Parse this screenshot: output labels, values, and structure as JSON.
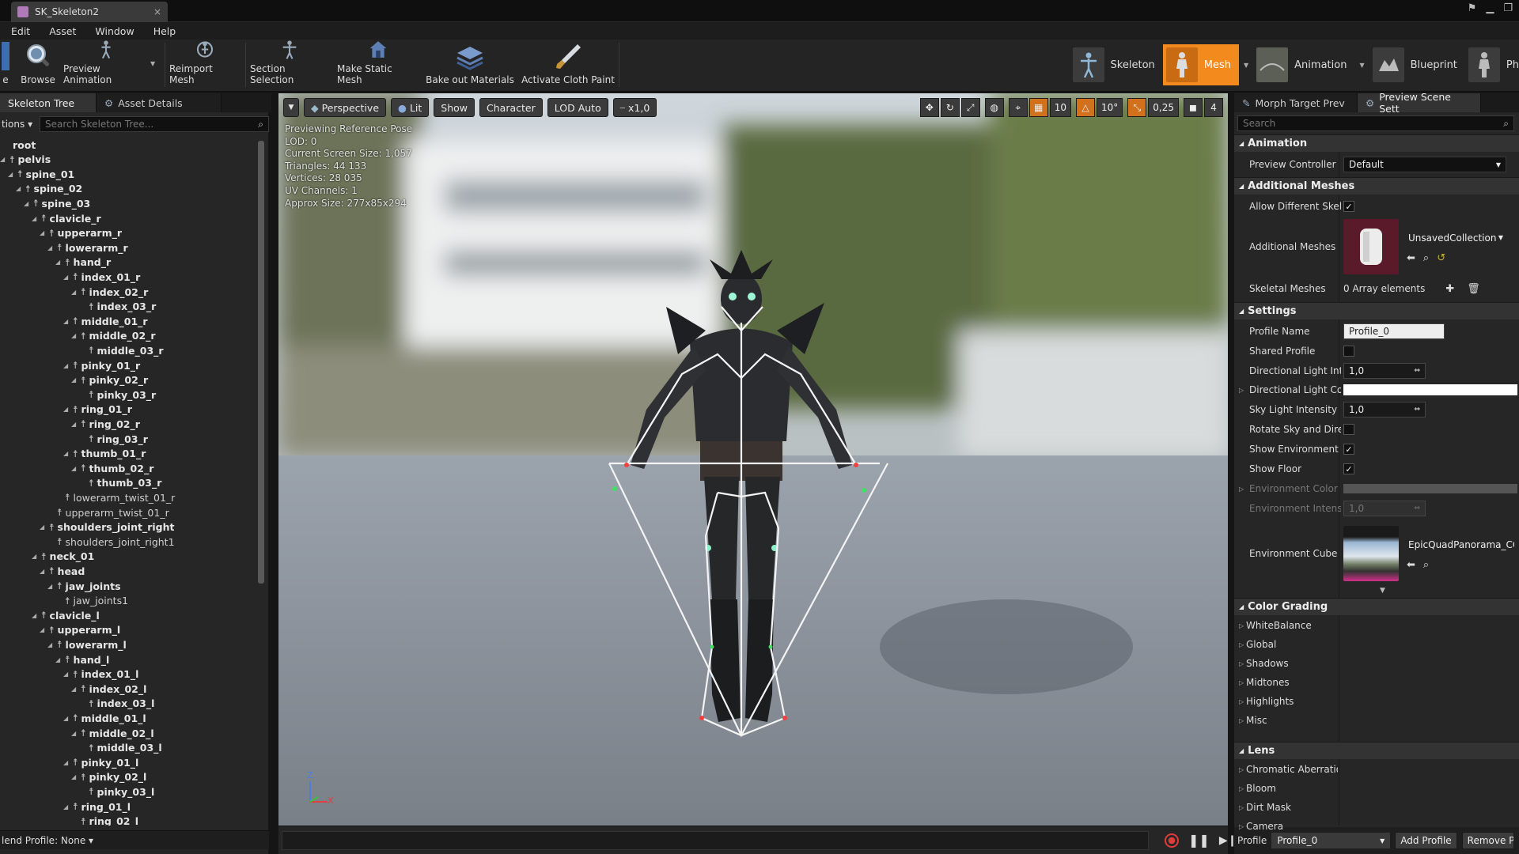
{
  "window": {
    "tab_title": "SK_Skeleton2"
  },
  "menu": [
    "Edit",
    "Asset",
    "Window",
    "Help"
  ],
  "toolbar": {
    "items": [
      {
        "label": "Browse",
        "icon": "magnifier-icon"
      },
      {
        "label": "Preview Animation",
        "icon": "running-figure-icon"
      },
      {
        "label": "Reimport Mesh",
        "icon": "reimport-icon"
      },
      {
        "label": "Section Selection",
        "icon": "mannequin-icon"
      },
      {
        "label": "Make Static Mesh",
        "icon": "house-icon"
      },
      {
        "label": "Bake out Materials",
        "icon": "layers-icon"
      },
      {
        "label": "Activate Cloth Paint",
        "icon": "brush-icon"
      }
    ],
    "first_partial_label": "e",
    "modes": [
      {
        "label": "Skeleton"
      },
      {
        "label": "Mesh",
        "active": true
      },
      {
        "label": "Animation"
      },
      {
        "label": "Blueprint"
      },
      {
        "label": "Ph"
      }
    ]
  },
  "left_panel": {
    "tabs": [
      "Skeleton Tree",
      "Asset Details"
    ],
    "options_label": "tions",
    "search_placeholder": "Search Skeleton Tree...",
    "bones": [
      {
        "name": "root",
        "depth": 0,
        "bold": true
      },
      {
        "name": "pelvis",
        "depth": 0,
        "bold": true
      },
      {
        "name": "spine_01",
        "depth": 1,
        "bold": true
      },
      {
        "name": "spine_02",
        "depth": 2,
        "bold": true
      },
      {
        "name": "spine_03",
        "depth": 3,
        "bold": true
      },
      {
        "name": "clavicle_r",
        "depth": 4,
        "bold": true
      },
      {
        "name": "upperarm_r",
        "depth": 5,
        "bold": true
      },
      {
        "name": "lowerarm_r",
        "depth": 6,
        "bold": true
      },
      {
        "name": "hand_r",
        "depth": 7,
        "bold": true
      },
      {
        "name": "index_01_r",
        "depth": 8,
        "bold": true
      },
      {
        "name": "index_02_r",
        "depth": 9,
        "bold": true
      },
      {
        "name": "index_03_r",
        "depth": 10,
        "bold": true
      },
      {
        "name": "middle_01_r",
        "depth": 8,
        "bold": true
      },
      {
        "name": "middle_02_r",
        "depth": 9,
        "bold": true
      },
      {
        "name": "middle_03_r",
        "depth": 10,
        "bold": true
      },
      {
        "name": "pinky_01_r",
        "depth": 8,
        "bold": true
      },
      {
        "name": "pinky_02_r",
        "depth": 9,
        "bold": true
      },
      {
        "name": "pinky_03_r",
        "depth": 10,
        "bold": true
      },
      {
        "name": "ring_01_r",
        "depth": 8,
        "bold": true
      },
      {
        "name": "ring_02_r",
        "depth": 9,
        "bold": true
      },
      {
        "name": "ring_03_r",
        "depth": 10,
        "bold": true
      },
      {
        "name": "thumb_01_r",
        "depth": 8,
        "bold": true
      },
      {
        "name": "thumb_02_r",
        "depth": 9,
        "bold": true
      },
      {
        "name": "thumb_03_r",
        "depth": 10,
        "bold": true
      },
      {
        "name": "lowerarm_twist_01_r",
        "depth": 7,
        "bold": false
      },
      {
        "name": "upperarm_twist_01_r",
        "depth": 6,
        "bold": false
      },
      {
        "name": "shoulders_joint_right",
        "depth": 5,
        "bold": true
      },
      {
        "name": "shoulders_joint_right1",
        "depth": 6,
        "bold": false
      },
      {
        "name": "neck_01",
        "depth": 4,
        "bold": true
      },
      {
        "name": "head",
        "depth": 5,
        "bold": true
      },
      {
        "name": "jaw_joints",
        "depth": 6,
        "bold": true
      },
      {
        "name": "jaw_joints1",
        "depth": 7,
        "bold": false
      },
      {
        "name": "clavicle_l",
        "depth": 4,
        "bold": true
      },
      {
        "name": "upperarm_l",
        "depth": 5,
        "bold": true
      },
      {
        "name": "lowerarm_l",
        "depth": 6,
        "bold": true
      },
      {
        "name": "hand_l",
        "depth": 7,
        "bold": true
      },
      {
        "name": "index_01_l",
        "depth": 8,
        "bold": true
      },
      {
        "name": "index_02_l",
        "depth": 9,
        "bold": true
      },
      {
        "name": "index_03_l",
        "depth": 10,
        "bold": true
      },
      {
        "name": "middle_01_l",
        "depth": 8,
        "bold": true
      },
      {
        "name": "middle_02_l",
        "depth": 9,
        "bold": true
      },
      {
        "name": "middle_03_l",
        "depth": 10,
        "bold": true
      },
      {
        "name": "pinky_01_l",
        "depth": 8,
        "bold": true
      },
      {
        "name": "pinky_02_l",
        "depth": 9,
        "bold": true
      },
      {
        "name": "pinky_03_l",
        "depth": 10,
        "bold": true
      },
      {
        "name": "ring_01_l",
        "depth": 8,
        "bold": true
      },
      {
        "name": "ring_02_l",
        "depth": 9,
        "bold": true
      }
    ],
    "blend_profile": "lend Profile: None"
  },
  "viewport": {
    "perspective": "Perspective",
    "lit": "Lit",
    "show": "Show",
    "character": "Character",
    "lod": "LOD Auto",
    "speed": "x1,0",
    "grid_snap": "10",
    "rot_snap": "10°",
    "scale_snap": "0,25",
    "cam_speed": "4",
    "stats": [
      "Previewing Reference Pose",
      "LOD: 0",
      "Current Screen Size: 1,057",
      "Triangles: 44 133",
      "Vertices: 28 035",
      "UV Channels: 1",
      "Approx Size: 277x85x294"
    ],
    "axis_z": "Z",
    "axis_x": "X"
  },
  "right_panel": {
    "tabs": [
      "Morph Target Prev",
      "Preview Scene Sett"
    ],
    "search_placeholder": "Search",
    "animation": {
      "header": "Animation",
      "preview_controller_label": "Preview Controller",
      "preview_controller_value": "Default"
    },
    "additional_meshes": {
      "header": "Additional Meshes",
      "allow_label": "Allow Different Skelet",
      "meshes_label": "Additional Meshes",
      "collection": "UnsavedCollection",
      "skeletal_label": "Skeletal Meshes",
      "skeletal_value": "0 Array elements"
    },
    "settings": {
      "header": "Settings",
      "profile_name_label": "Profile Name",
      "profile_name_value": "Profile_0",
      "shared_profile_label": "Shared Profile",
      "dir_intensity_label": "Directional Light Inten",
      "dir_intensity_value": "1,0",
      "dir_color_label": "Directional Light Colo",
      "sky_intensity_label": "Sky Light Intensity",
      "sky_intensity_value": "1,0",
      "rotate_label": "Rotate Sky and Direct",
      "show_env_label": "Show Environment",
      "show_floor_label": "Show Floor",
      "env_color_label": "Environment Color",
      "env_intensity_label": "Environment Intensity",
      "env_intensity_value": "1,0",
      "cube_map_label": "Environment Cube Ma",
      "cube_map_value": "EpicQuadPanorama_CC+E"
    },
    "color_grading": {
      "header": "Color Grading",
      "items": [
        "WhiteBalance",
        "Global",
        "Shadows",
        "Midtones",
        "Highlights",
        "Misc"
      ]
    },
    "lens": {
      "header": "Lens",
      "items": [
        "Chromatic Aberration",
        "Bloom",
        "Dirt Mask",
        "Camera"
      ]
    },
    "bottom": {
      "profile_label": "Profile",
      "profile_value": "Profile_0",
      "add_profile": "Add Profile",
      "remove_profile": "Remove Pr"
    }
  }
}
